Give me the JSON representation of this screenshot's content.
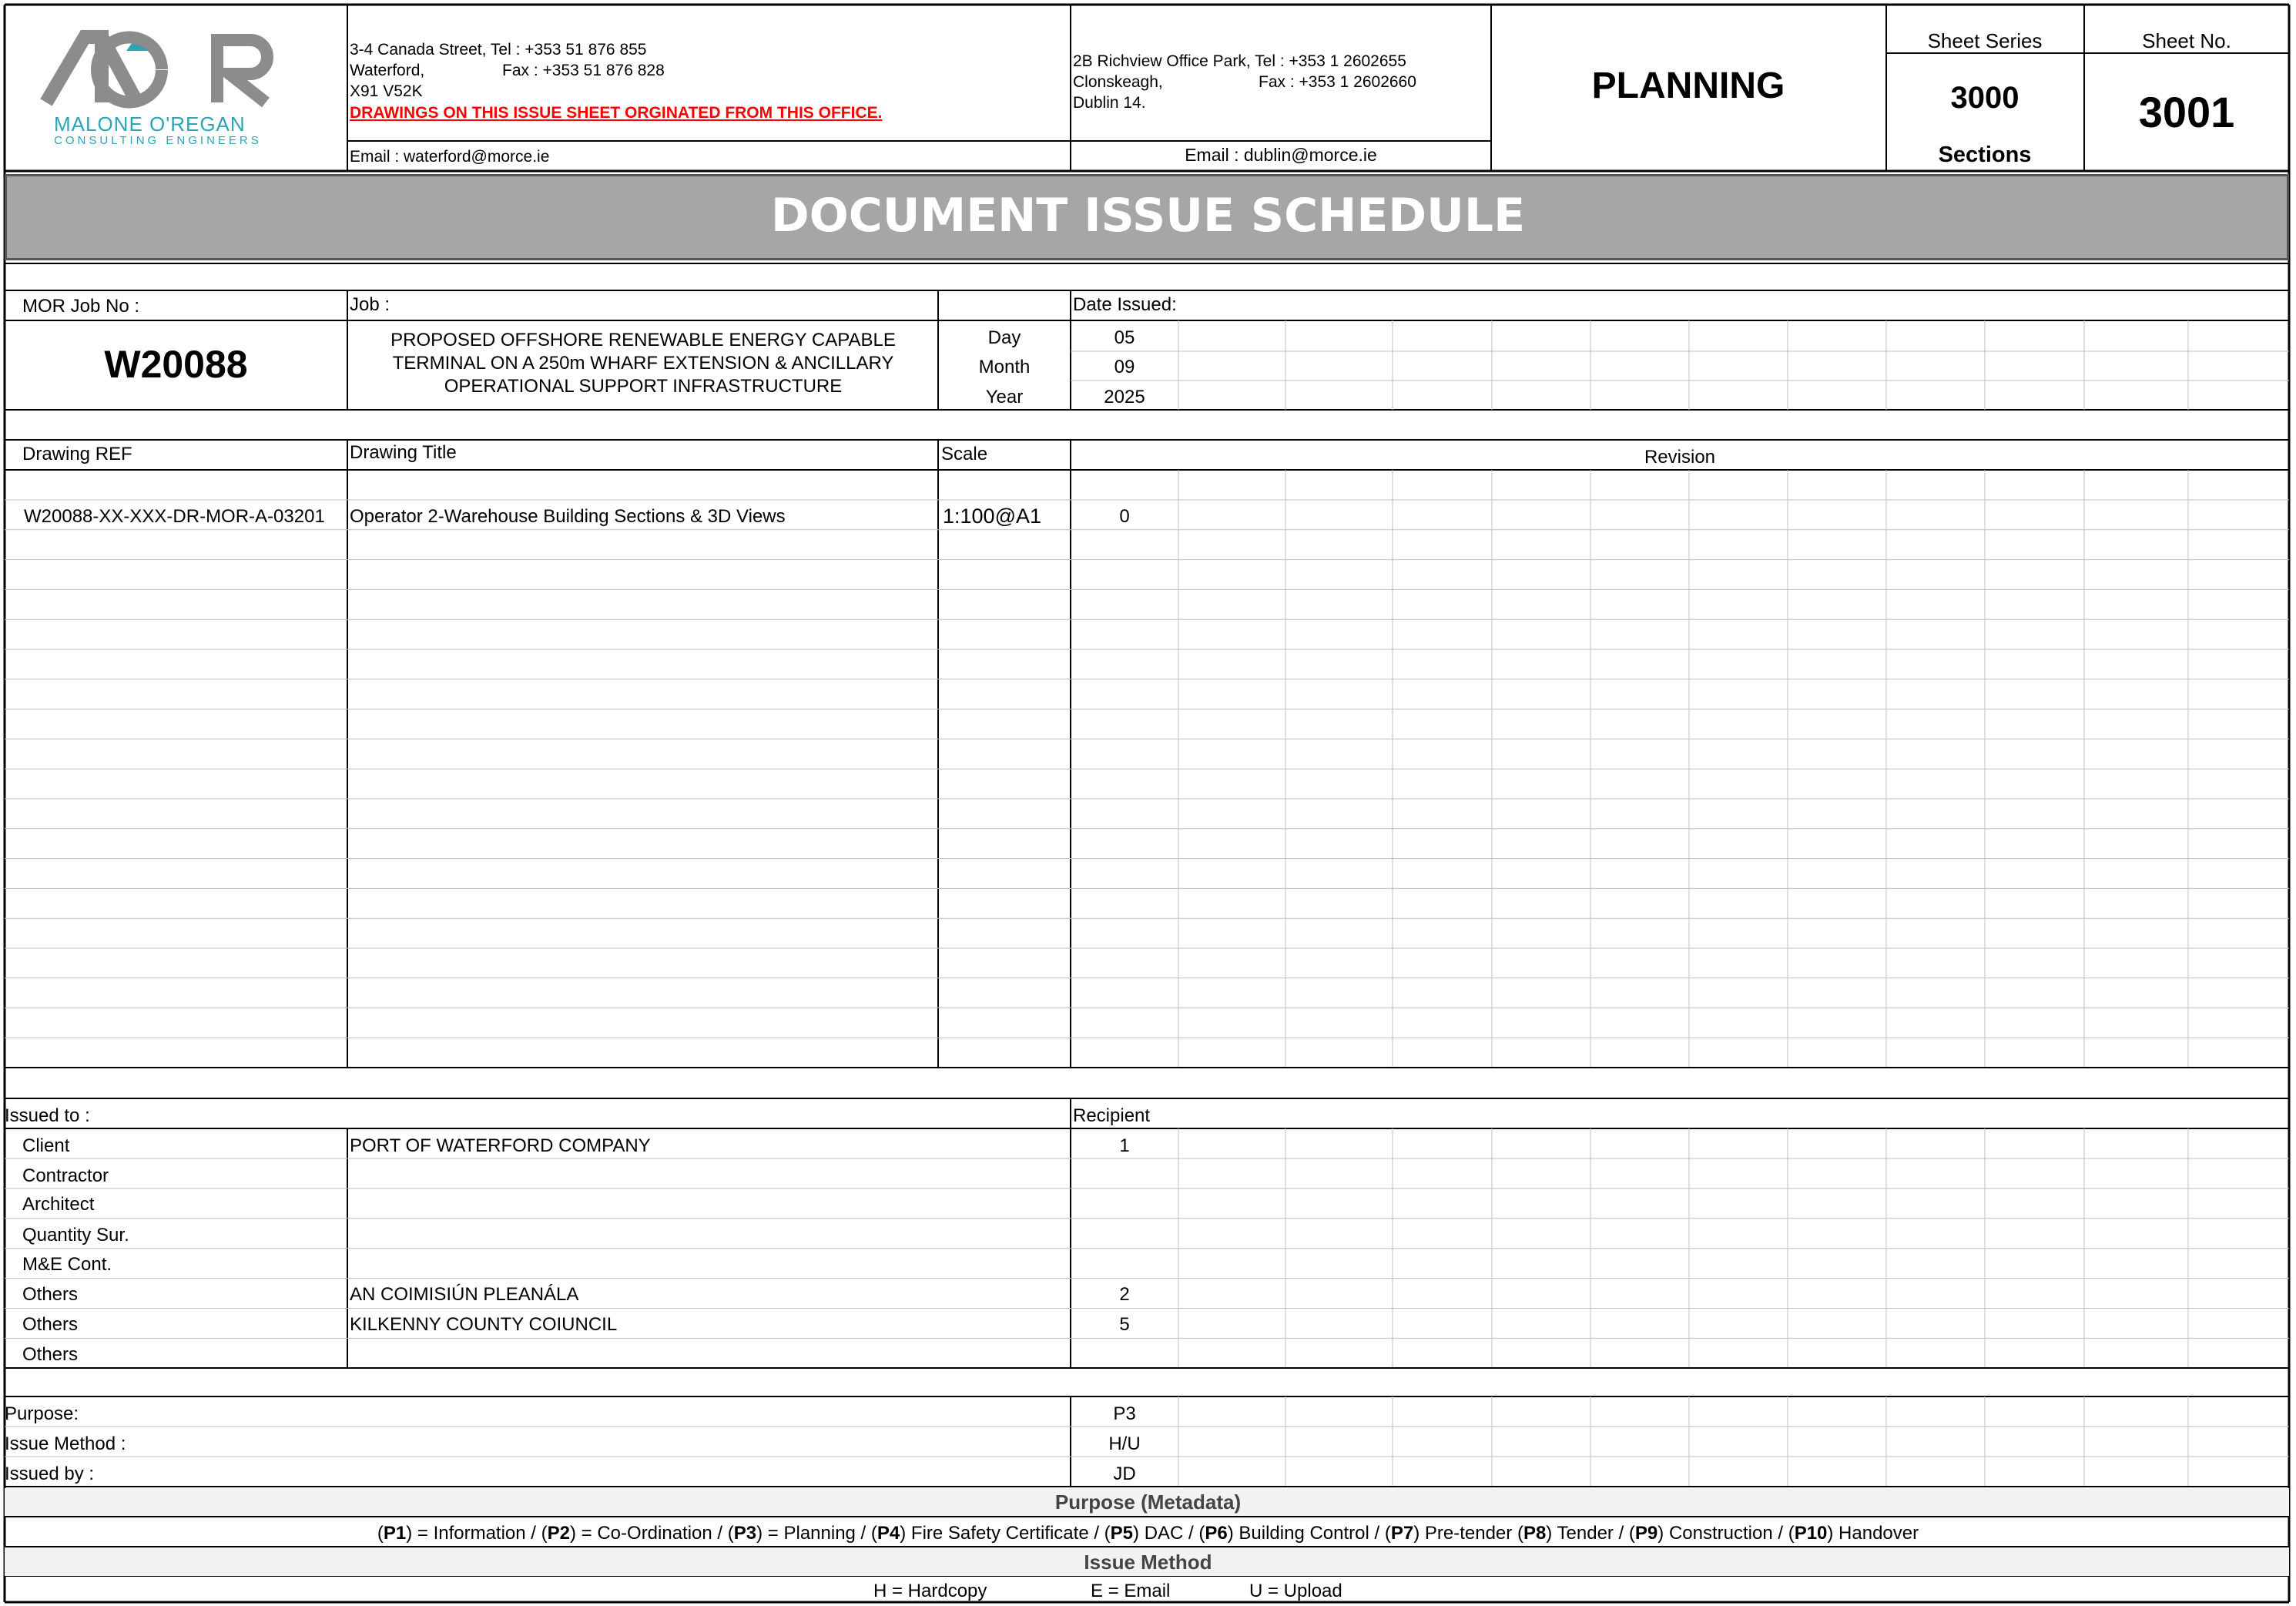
{
  "logo": {
    "letters": "MOR",
    "company_line1": "MALONE O'REGAN",
    "company_line2": "CONSULTING ENGINEERS"
  },
  "waterford_office": {
    "line1": "3-4 Canada Street,  Tel : +353 51 876 855",
    "line2_left": "Waterford,",
    "line2_right": "Fax : +353 51 876 828",
    "line3": "X91 V52K",
    "notice": "DRAWINGS ON THIS ISSUE SHEET ORGINATED FROM THIS OFFICE.",
    "email": "Email : waterford@morce.ie"
  },
  "dublin_office": {
    "line1": "2B Richview Office Park, Tel : +353 1 2602655",
    "line2_left": "Clonskeagh,",
    "line2_right": "Fax : +353 1 2602660",
    "line3": "Dublin 14.",
    "email": "Email : dublin@morce.ie"
  },
  "stage": "PLANNING",
  "sheet_series": {
    "label": "Sheet Series",
    "number": "3000",
    "name": "Sections"
  },
  "sheet_no": {
    "label": "Sheet No.",
    "number": "3001"
  },
  "banner": "DOCUMENT ISSUE SCHEDULE",
  "job": {
    "job_no_label": "MOR Job No :",
    "job_no": "W20088",
    "job_label": "Job :",
    "description_lines": [
      "PROPOSED OFFSHORE RENEWABLE ENERGY CAPABLE",
      "TERMINAL ON A 250m WHARF EXTENSION & ANCILLARY",
      "OPERATIONAL SUPPORT INFRASTRUCTURE"
    ],
    "date_issued_label": "Date Issued:",
    "day_label": "Day",
    "day": "05",
    "month_label": "Month",
    "month": "09",
    "year_label": "Year",
    "year": "2025"
  },
  "drawings": {
    "headers": {
      "ref": "Drawing REF",
      "title": "Drawing Title",
      "scale": "Scale",
      "revision": "Revision"
    },
    "rows": [
      {
        "ref": "W20088-XX-XXX-DR-MOR-A-03201",
        "title": "Operator 2-Warehouse Building Sections & 3D Views",
        "scale": "1:100@A1",
        "revision": "0"
      }
    ]
  },
  "issued_to": {
    "label": "Issued to :",
    "recipient_label": "Recipient",
    "rows": [
      {
        "role": "Client",
        "name": "PORT OF WATERFORD COMPANY",
        "copies": "1"
      },
      {
        "role": "Contractor",
        "name": "",
        "copies": ""
      },
      {
        "role": "Architect",
        "name": "",
        "copies": ""
      },
      {
        "role": "Quantity Sur.",
        "name": "",
        "copies": ""
      },
      {
        "role": "M&E Cont.",
        "name": "",
        "copies": ""
      },
      {
        "role": "Others",
        "name": "AN COIMISIÚN PLEANÁLA",
        "copies": "2"
      },
      {
        "role": "Others",
        "name": "KILKENNY COUNTY COIUNCIL",
        "copies": "5"
      },
      {
        "role": "Others",
        "name": "",
        "copies": ""
      }
    ]
  },
  "issue_info": {
    "purpose_label": "Purpose:",
    "purpose": "P3",
    "method_label": "Issue Method :",
    "method": "H/U",
    "issued_by_label": "Issued by :",
    "issued_by": "JD"
  },
  "legend": {
    "purpose_title": "Purpose (Metadata)",
    "purpose_items": [
      {
        "code": "P1",
        "text": " = Information / "
      },
      {
        "code": "P2",
        "text": " = Co-Ordination / "
      },
      {
        "code": "P3",
        "text": " = Planning / "
      },
      {
        "code": "P4",
        "text": " Fire Safety Certificate / "
      },
      {
        "code": "P5",
        "text": " DAC / "
      },
      {
        "code": "P6",
        "text": " Building Control / "
      },
      {
        "code": "P7",
        "text": " Pre-tender "
      },
      {
        "code": "P8",
        "text": " Tender / "
      },
      {
        "code": "P9",
        "text": " Construction / "
      },
      {
        "code": "P10",
        "text": " Handover"
      }
    ],
    "method_title": "Issue Method",
    "method_hardcopy": "H = Hardcopy",
    "method_email": "E = Email",
    "method_upload": "U = Upload"
  },
  "colors": {
    "banner_bg": "#a6a6a6",
    "notice": "#ff0000",
    "logo_grey": "#8c8c8c",
    "logo_teal": "#2aa5b6",
    "legend_bg": "#f2f2f2"
  }
}
